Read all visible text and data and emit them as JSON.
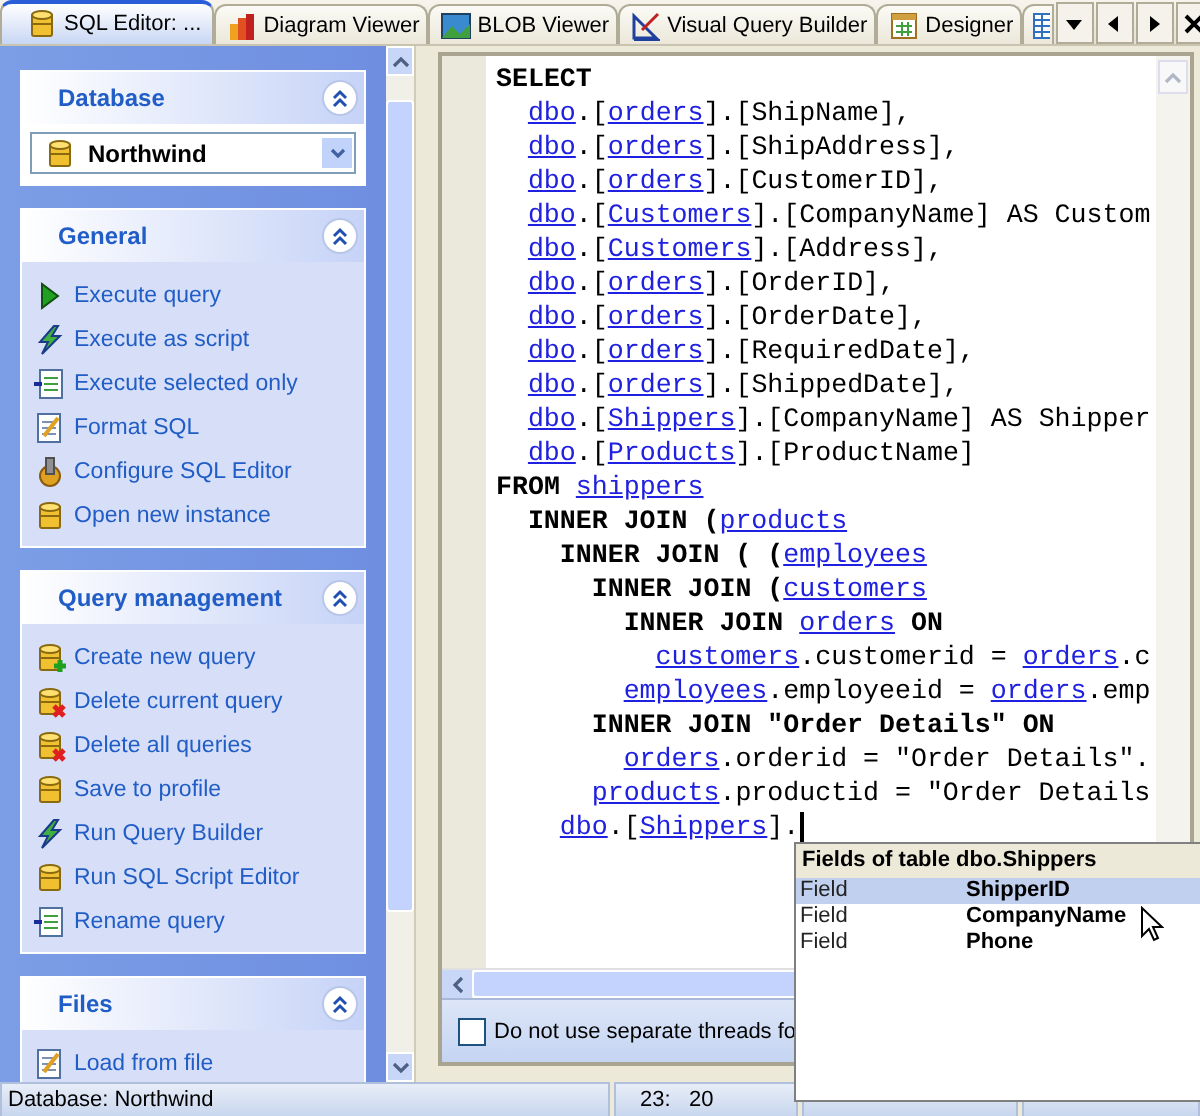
{
  "tabs": [
    {
      "label": "SQL Editor: ...",
      "selected": true
    },
    {
      "label": "Diagram Viewer",
      "selected": false
    },
    {
      "label": "BLOB Viewer",
      "selected": false
    },
    {
      "label": "Visual Query Builder",
      "selected": false
    },
    {
      "label": "Designer",
      "selected": false
    }
  ],
  "sidebar": {
    "panels": [
      {
        "title": "Database",
        "kind": "select",
        "value": "Northwind"
      },
      {
        "title": "General",
        "kind": "list",
        "items": [
          "Execute query",
          "Execute as script",
          "Execute selected only",
          "Format SQL",
          "Configure SQL Editor",
          "Open new instance"
        ]
      },
      {
        "title": "Query management",
        "kind": "list",
        "items": [
          "Create new query",
          "Delete current query",
          "Delete all queries",
          "Save to profile",
          "Run Query Builder",
          "Run SQL Script Editor",
          "Rename query"
        ]
      },
      {
        "title": "Files",
        "kind": "list",
        "items": [
          "Load from file"
        ]
      }
    ]
  },
  "editor": {
    "lines": [
      {
        "segments": [
          {
            "kind": "keyword",
            "text": "SELECT"
          }
        ],
        "children": [
          {
            "segments": [
              {
                "kind": "link",
                "text": "dbo"
              },
              {
                "kind": "text",
                "text": ".["
              },
              {
                "kind": "link",
                "text": "orders"
              },
              {
                "kind": "text",
                "text": "].[ShipName],"
              }
            ]
          },
          {
            "segments": [
              {
                "kind": "link",
                "text": "dbo"
              },
              {
                "kind": "text",
                "text": ".["
              },
              {
                "kind": "link",
                "text": "orders"
              },
              {
                "kind": "text",
                "text": "].[ShipAddress],"
              }
            ]
          },
          {
            "segments": [
              {
                "kind": "link",
                "text": "dbo"
              },
              {
                "kind": "text",
                "text": ".["
              },
              {
                "kind": "link",
                "text": "orders"
              },
              {
                "kind": "text",
                "text": "].[CustomerID],"
              }
            ]
          },
          {
            "segments": [
              {
                "kind": "link",
                "text": "dbo"
              },
              {
                "kind": "text",
                "text": ".["
              },
              {
                "kind": "link",
                "text": "Customers"
              },
              {
                "kind": "text",
                "text": "].[CompanyName] AS Custom"
              }
            ]
          },
          {
            "segments": [
              {
                "kind": "link",
                "text": "dbo"
              },
              {
                "kind": "text",
                "text": ".["
              },
              {
                "kind": "link",
                "text": "Customers"
              },
              {
                "kind": "text",
                "text": "].[Address],"
              }
            ]
          },
          {
            "segments": [
              {
                "kind": "link",
                "text": "dbo"
              },
              {
                "kind": "text",
                "text": ".["
              },
              {
                "kind": "link",
                "text": "orders"
              },
              {
                "kind": "text",
                "text": "].[OrderID],"
              }
            ]
          },
          {
            "segments": [
              {
                "kind": "link",
                "text": "dbo"
              },
              {
                "kind": "text",
                "text": ".["
              },
              {
                "kind": "link",
                "text": "orders"
              },
              {
                "kind": "text",
                "text": "].[OrderDate],"
              }
            ]
          },
          {
            "segments": [
              {
                "kind": "link",
                "text": "dbo"
              },
              {
                "kind": "text",
                "text": ".["
              },
              {
                "kind": "link",
                "text": "orders"
              },
              {
                "kind": "text",
                "text": "].[RequiredDate],"
              }
            ]
          },
          {
            "segments": [
              {
                "kind": "link",
                "text": "dbo"
              },
              {
                "kind": "text",
                "text": ".["
              },
              {
                "kind": "link",
                "text": "orders"
              },
              {
                "kind": "text",
                "text": "].[ShippedDate],"
              }
            ]
          },
          {
            "segments": [
              {
                "kind": "link",
                "text": "dbo"
              },
              {
                "kind": "text",
                "text": ".["
              },
              {
                "kind": "link",
                "text": "Shippers"
              },
              {
                "kind": "text",
                "text": "].[CompanyName] AS Shipper"
              }
            ]
          },
          {
            "segments": [
              {
                "kind": "link",
                "text": "dbo"
              },
              {
                "kind": "text",
                "text": ".["
              },
              {
                "kind": "link",
                "text": "Products"
              },
              {
                "kind": "text",
                "text": "].[ProductName]"
              }
            ]
          }
        ]
      },
      {
        "segments": [
          {
            "kind": "keyword",
            "text": "FROM "
          },
          {
            "kind": "link",
            "text": "shippers"
          }
        ],
        "children": [
          {
            "segments": [
              {
                "kind": "keyword",
                "text": "INNER JOIN ("
              },
              {
                "kind": "link",
                "text": "products"
              }
            ],
            "children": [
              {
                "segments": [
                  {
                    "kind": "keyword",
                    "text": "INNER JOIN ( ("
                  },
                  {
                    "kind": "link",
                    "text": "employees"
                  }
                ],
                "children": [
                  {
                    "segments": [
                      {
                        "kind": "keyword",
                        "text": "INNER JOIN ("
                      },
                      {
                        "kind": "link",
                        "text": "customers"
                      }
                    ],
                    "children": [
                      {
                        "segments": [
                          {
                            "kind": "keyword",
                            "text": "INNER JOIN "
                          },
                          {
                            "kind": "link",
                            "text": "orders"
                          },
                          {
                            "kind": "keyword",
                            "text": " ON"
                          }
                        ],
                        "children": [
                          {
                            "segments": [
                              {
                                "kind": "link",
                                "text": "customers"
                              },
                              {
                                "kind": "text",
                                "text": ".customerid = "
                              },
                              {
                                "kind": "link",
                                "text": "orders"
                              },
                              {
                                "kind": "text",
                                "text": ".c"
                              }
                            ]
                          }
                        ]
                      },
                      {
                        "segments": [
                          {
                            "kind": "link",
                            "text": "employees"
                          },
                          {
                            "kind": "text",
                            "text": ".employeeid = "
                          },
                          {
                            "kind": "link",
                            "text": "orders"
                          },
                          {
                            "kind": "text",
                            "text": ".emp"
                          }
                        ]
                      }
                    ]
                  },
                  {
                    "segments": [
                      {
                        "kind": "keyword",
                        "text": "INNER JOIN \"Order Details\" ON"
                      }
                    ],
                    "children": [
                      {
                        "segments": [
                          {
                            "kind": "link",
                            "text": "orders"
                          },
                          {
                            "kind": "text",
                            "text": ".orderid = \"Order Details\"."
                          }
                        ]
                      }
                    ]
                  },
                  {
                    "segments": [
                      {
                        "kind": "link",
                        "text": "products"
                      },
                      {
                        "kind": "text",
                        "text": ".productid = \"Order Details"
                      }
                    ]
                  }
                ]
              },
              {
                "segments": [
                  {
                    "kind": "link",
                    "text": "dbo"
                  },
                  {
                    "kind": "text",
                    "text": ".["
                  },
                  {
                    "kind": "link",
                    "text": "Shippers"
                  },
                  {
                    "kind": "text",
                    "text": "]."
                  }
                ],
                "cursor": true
              }
            ]
          }
        ]
      }
    ],
    "option": {
      "label": "Do not use separate threads fo",
      "checked": false
    }
  },
  "completion": {
    "title": "Fields of table dbo.Shippers",
    "rows": [
      {
        "kind": "Field",
        "name": "ShipperID",
        "selected": true
      },
      {
        "kind": "Field",
        "name": "CompanyName",
        "selected": false
      },
      {
        "kind": "Field",
        "name": "Phone",
        "selected": false
      }
    ]
  },
  "status_bar": [
    "Database: Northwind",
    "23:   20"
  ]
}
